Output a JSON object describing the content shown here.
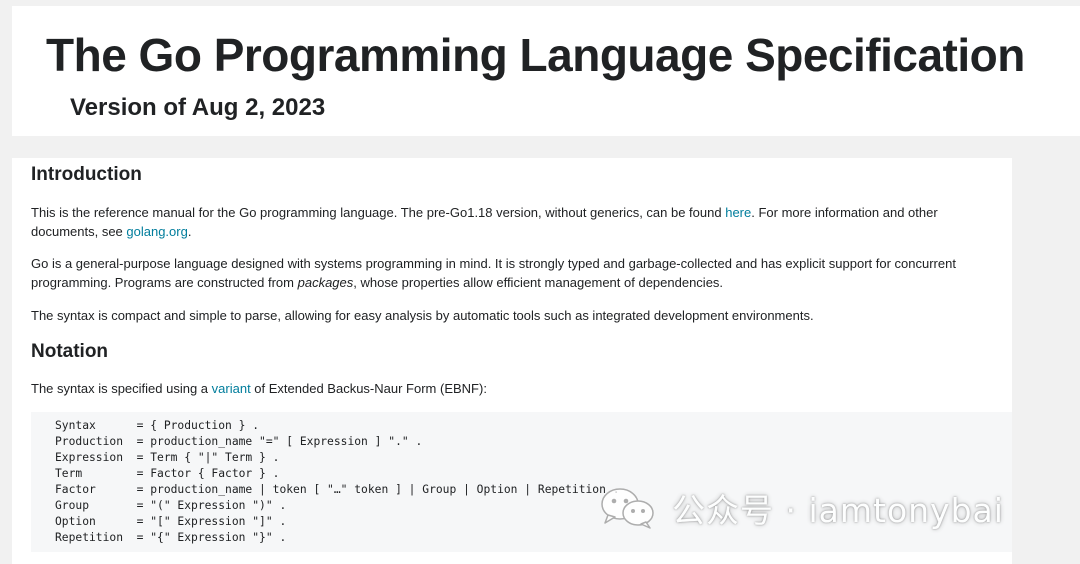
{
  "header": {
    "title": "The Go Programming Language Specification",
    "subtitle": "Version of Aug 2, 2023"
  },
  "introduction": {
    "heading": "Introduction",
    "p1": {
      "before_link1": "This is the reference manual for the Go programming language. The pre-Go1.18 version, without generics, can be found ",
      "link1": "here",
      "between_links": ". For more information and other documents, see ",
      "link2": "golang.org",
      "after_link2": "."
    },
    "p2": {
      "before_em": "Go is a general-purpose language designed with systems programming in mind. It is strongly typed and garbage-collected and has explicit support for concurrent programming. Programs are constructed from ",
      "em": "packages",
      "after_em": ", whose properties allow efficient management of dependencies."
    },
    "p3": "The syntax is compact and simple to parse, allowing for easy analysis by automatic tools such as integrated development environments."
  },
  "notation": {
    "heading": "Notation",
    "p1": {
      "before_link": "The syntax is specified using a ",
      "link": "variant",
      "after_link": " of Extended Backus-Naur Form (EBNF):"
    },
    "code_lines": [
      "Syntax      = { Production } .",
      "Production  = production_name \"=\" [ Expression ] \".\" .",
      "Expression  = Term { \"|\" Term } .",
      "Term        = Factor { Factor } .",
      "Factor      = production_name | token [ \"…\" token ] | Group | Option | Repetition .",
      "Group       = \"(\" Expression \")\" .",
      "Option      = \"[\" Expression \"]\" .",
      "Repetition  = \"{\" Expression \"}\" ."
    ]
  },
  "watermark": {
    "text": "公众号 · iamtonybai",
    "icon": "wechat-icon"
  },
  "colors": {
    "link": "#007d9c",
    "text": "#202224",
    "code_background": "#f6f7f8",
    "page_background": "#f1f1f1"
  }
}
